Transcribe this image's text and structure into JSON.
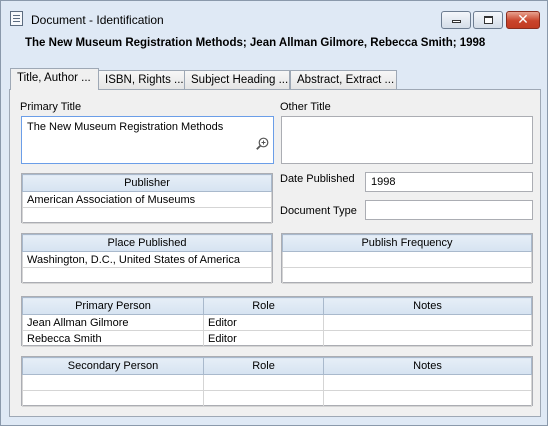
{
  "window": {
    "title": "Document - Identification",
    "buttons": {
      "minimize": "minimize",
      "maximize": "maximize",
      "close": "✕"
    }
  },
  "record_heading": "The New Museum Registration Methods; Jean Allman Gilmore, Rebecca Smith; 1998",
  "tabs": [
    {
      "label": "Title, Author ...",
      "active": true
    },
    {
      "label": "ISBN, Rights ...",
      "active": false
    },
    {
      "label": "Subject Heading ...",
      "active": false
    },
    {
      "label": "Abstract, Extract ...",
      "active": false
    }
  ],
  "fields": {
    "primary_title": {
      "label": "Primary Title",
      "value": "The New Museum Registration Methods"
    },
    "other_title": {
      "label": "Other Title",
      "value": ""
    },
    "date_published": {
      "label": "Date Published",
      "value": "1998"
    },
    "document_type": {
      "label": "Document Type",
      "value": ""
    }
  },
  "publisher_grid": {
    "header": "Publisher",
    "rows": [
      "American Association of Museums",
      ""
    ]
  },
  "place_grid": {
    "header": "Place Published",
    "rows": [
      "Washington, D.C., United States of America",
      ""
    ]
  },
  "frequency_grid": {
    "header": "Publish Frequency",
    "rows": [
      "",
      ""
    ]
  },
  "primary_person_grid": {
    "headers": [
      "Primary Person",
      "Role",
      "Notes"
    ],
    "rows": [
      [
        "Jean Allman Gilmore",
        "Editor",
        ""
      ],
      [
        "Rebecca Smith",
        "Editor",
        ""
      ]
    ]
  },
  "secondary_person_grid": {
    "headers": [
      "Secondary Person",
      "Role",
      "Notes"
    ],
    "rows": [
      [
        "",
        "",
        ""
      ],
      [
        "",
        "",
        ""
      ]
    ]
  },
  "icons": {
    "app": "document-icon",
    "zoom": "zoom-in-icon"
  }
}
